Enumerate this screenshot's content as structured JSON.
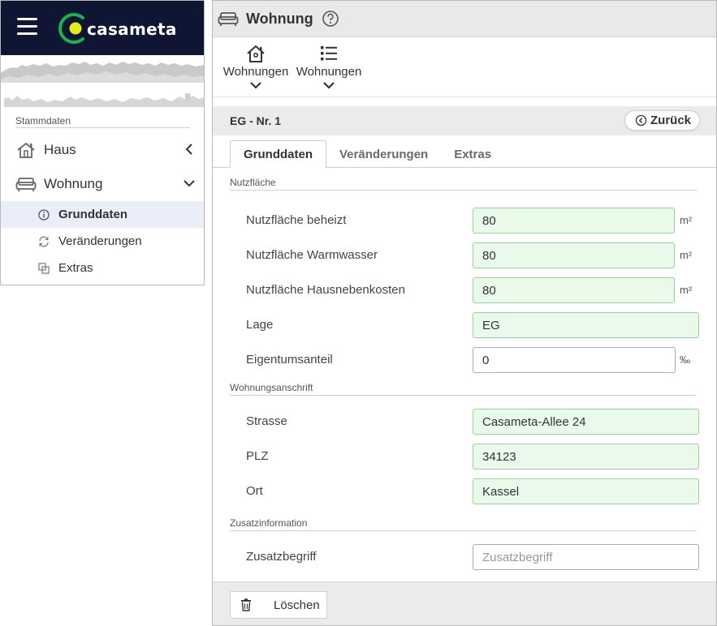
{
  "brand": {
    "name": "casameta",
    "accent": "#e5ec1a",
    "logo_ring": "#18b548",
    "navy": "#0f1633"
  },
  "sidebar": {
    "section_label": "Stammdaten",
    "items": [
      {
        "label": "Haus",
        "icon": "house-icon",
        "chevron": "chevron-left-icon"
      },
      {
        "label": "Wohnung",
        "icon": "sofa-icon",
        "chevron": "chevron-down-icon"
      }
    ],
    "sub_items": [
      {
        "label": "Grunddaten",
        "icon": "info-icon",
        "active": true
      },
      {
        "label": "Veränderungen",
        "icon": "refresh-icon",
        "active": false
      },
      {
        "label": "Extras",
        "icon": "copy-icon",
        "active": false
      }
    ]
  },
  "header": {
    "title": "Wohnung",
    "help_icon": "help-icon"
  },
  "toolbar": {
    "buttons": [
      {
        "label": "Wohnungen",
        "icon": "house-icon"
      },
      {
        "label": "Wohnungen",
        "icon": "list-icon"
      }
    ]
  },
  "record": {
    "title": "EG - Nr. 1",
    "back_label": "Zurück"
  },
  "tabs": [
    {
      "label": "Grunddaten",
      "active": true
    },
    {
      "label": "Veränderungen",
      "active": false
    },
    {
      "label": "Extras",
      "active": false
    }
  ],
  "form": {
    "groups": [
      {
        "label": "Nutzfläche",
        "fields": [
          {
            "label": "Nutzfläche beheizt",
            "value": "80",
            "unit": "m²"
          },
          {
            "label": "Nutzfläche Warmwasser",
            "value": "80",
            "unit": "m²"
          },
          {
            "label": "Nutzfläche Hausnebenkosten",
            "value": "80",
            "unit": "m²"
          },
          {
            "label": "Lage",
            "value": "EG",
            "unit": ""
          },
          {
            "label": "Eigentumsanteil",
            "value": "0",
            "unit": "‰"
          }
        ]
      },
      {
        "label": "Wohnungsanschrift",
        "fields": [
          {
            "label": "Strasse",
            "value": "Casameta-Allee 24"
          },
          {
            "label": "PLZ",
            "value": "34123"
          },
          {
            "label": "Ort",
            "value": "Kassel"
          }
        ]
      },
      {
        "label": "Zusatzinformation",
        "fields": [
          {
            "label": "Zusatzbegriff",
            "value": "",
            "placeholder": "Zusatzbegriff"
          }
        ]
      }
    ]
  },
  "footer": {
    "delete_label": "Löschen",
    "delete_icon": "trash-icon"
  }
}
